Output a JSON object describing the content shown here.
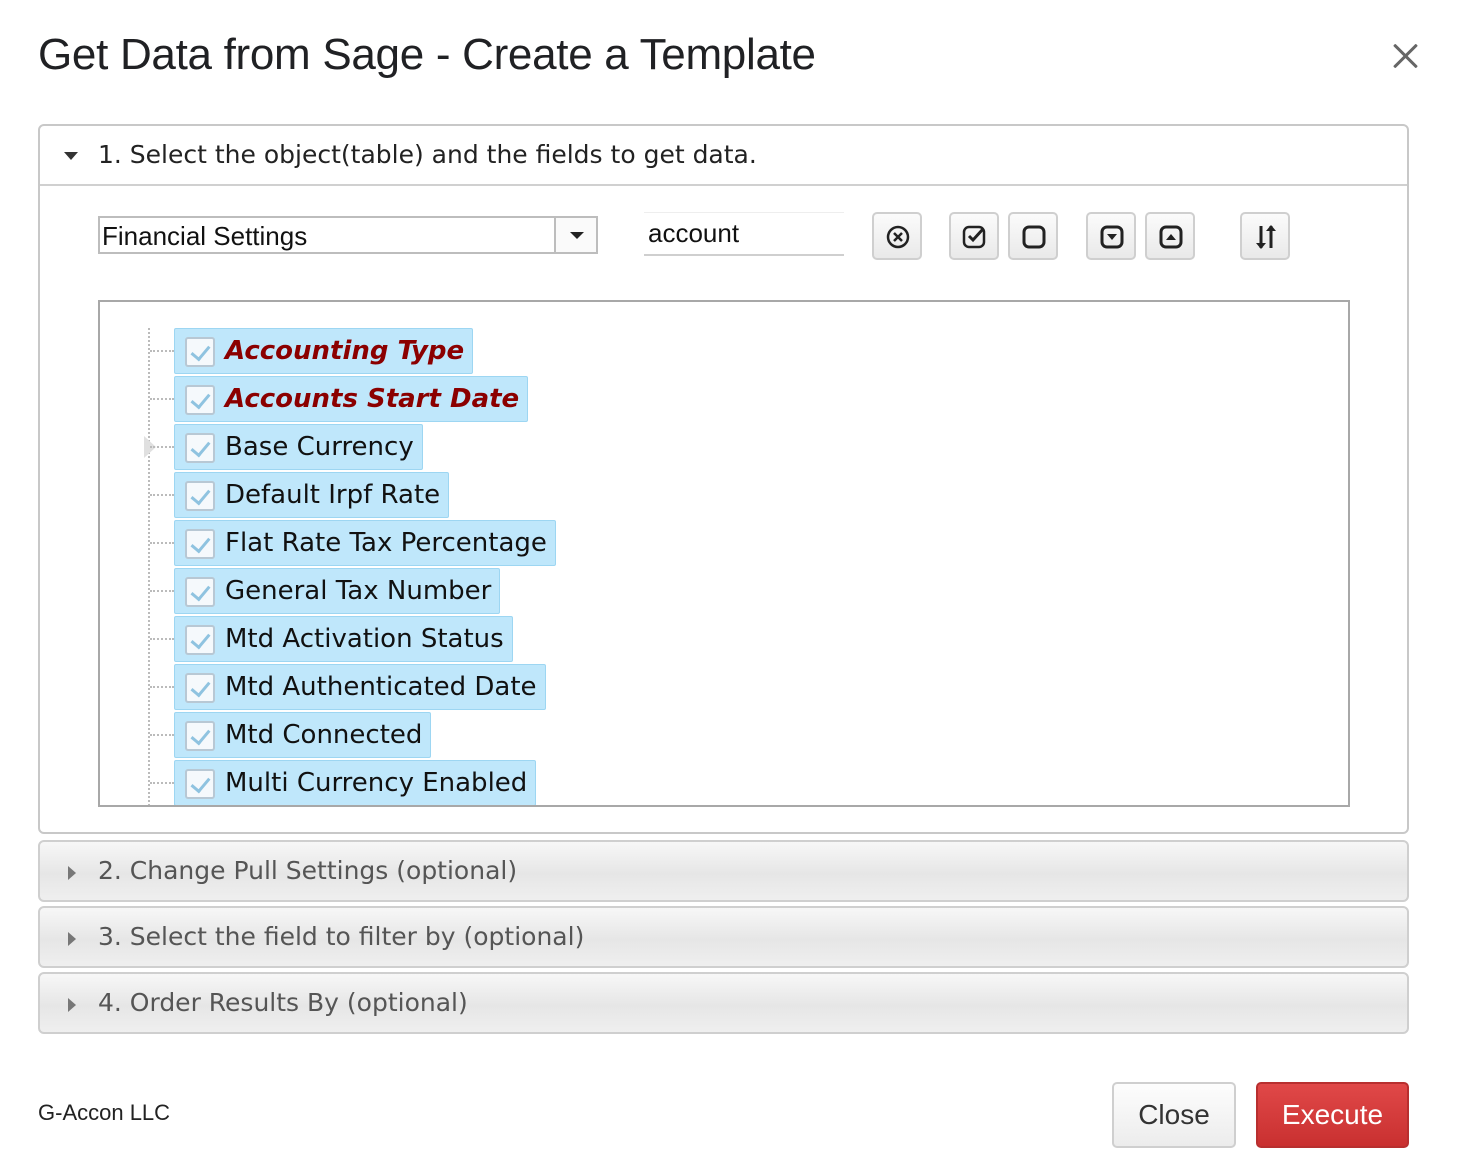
{
  "dialog": {
    "title": "Get Data from Sage - Create a Template"
  },
  "section1": {
    "label": "1. Select the object(table) and the fields to get data.",
    "object_select": {
      "value": "Financial Settings"
    },
    "search": {
      "value": "account"
    },
    "toolbar_icons": [
      "clear-circle-x-icon",
      "check-all-icon",
      "uncheck-all-icon",
      "move-down-icon",
      "move-up-icon",
      "sort-icon"
    ],
    "fields": [
      {
        "label": "Accounting Type",
        "required": true,
        "checked": true
      },
      {
        "label": "Accounts Start Date",
        "required": true,
        "checked": true
      },
      {
        "label": "Base Currency",
        "required": false,
        "checked": true
      },
      {
        "label": "Default Irpf Rate",
        "required": false,
        "checked": true
      },
      {
        "label": "Flat Rate Tax Percentage",
        "required": false,
        "checked": true
      },
      {
        "label": "General Tax Number",
        "required": false,
        "checked": true
      },
      {
        "label": "Mtd Activation Status",
        "required": false,
        "checked": true
      },
      {
        "label": "Mtd Authenticated Date",
        "required": false,
        "checked": true
      },
      {
        "label": "Mtd Connected",
        "required": false,
        "checked": true
      },
      {
        "label": "Multi Currency Enabled",
        "required": false,
        "checked": true
      }
    ]
  },
  "section2": {
    "label": "2. Change Pull Settings (optional)"
  },
  "section3": {
    "label": "3. Select the field to filter by (optional)"
  },
  "section4": {
    "label": "4. Order Results By (optional)"
  },
  "footer": {
    "company": "G-Accon LLC",
    "close_label": "Close",
    "execute_label": "Execute"
  },
  "colors": {
    "required_field": "#8b0000",
    "selected_chip": "#bfe7fb",
    "execute_button": "#d13b3b"
  }
}
